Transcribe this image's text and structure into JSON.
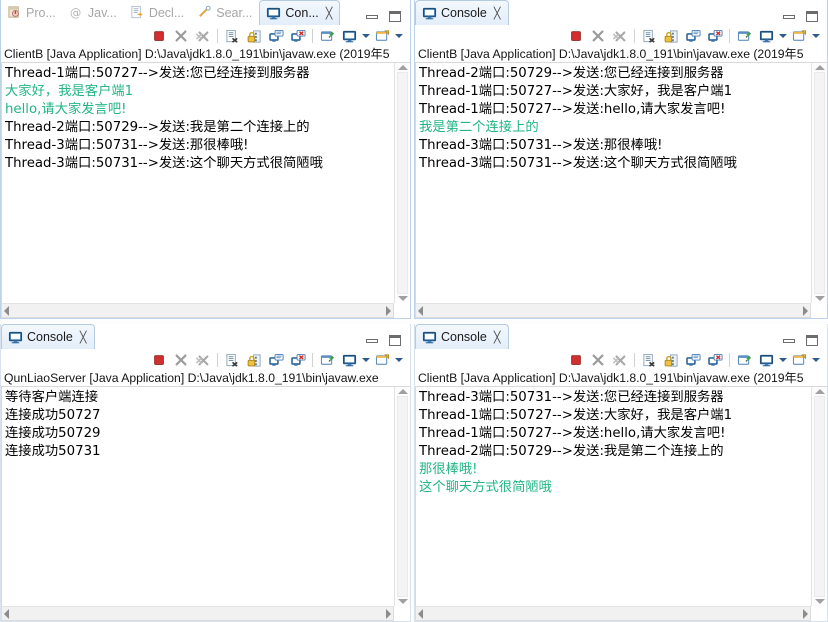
{
  "window": {
    "minimize_label": "Minimize",
    "maximize_label": "Maximize"
  },
  "toolbar": {
    "icons": [
      {
        "name": "terminate-icon",
        "label": "Terminate"
      },
      {
        "name": "remove-launch-icon",
        "label": "Remove Launch"
      },
      {
        "name": "remove-all-terminated-icon",
        "label": "Remove All Terminated Launches"
      },
      {
        "name": "clear-console-icon",
        "label": "Clear Console"
      },
      {
        "name": "scroll-lock-icon",
        "label": "Scroll Lock"
      },
      {
        "name": "show-console-on-output-icon",
        "label": "Show Console When Standard Out Changes"
      },
      {
        "name": "show-console-on-error-icon",
        "label": "Show Console When Standard Error Changes"
      },
      {
        "name": "pin-console-icon",
        "label": "Pin Console"
      },
      {
        "name": "display-selected-console-icon",
        "label": "Display Selected Console"
      },
      {
        "name": "open-console-icon",
        "label": "Open Console"
      }
    ]
  },
  "panels": {
    "top_left": {
      "tabs": [
        {
          "label": "Pro...",
          "icon": "package-explorer-icon",
          "active": false,
          "closable": false
        },
        {
          "label": "Jav...",
          "icon": "javadoc-icon",
          "active": false,
          "closable": false
        },
        {
          "label": "Decl...",
          "icon": "declaration-icon",
          "active": false,
          "closable": false
        },
        {
          "label": "Sear...",
          "icon": "search-icon",
          "active": false,
          "closable": false
        },
        {
          "label": "Con...",
          "icon": "console-icon",
          "active": true,
          "closable": true
        }
      ],
      "launch_line": "ClientB [Java Application] D:\\Java\\jdk1.8.0_191\\bin\\javaw.exe (2019年5",
      "lines": [
        {
          "text": "Thread-1端口:50727-->发送:您已经连接到服务器",
          "color": "black"
        },
        {
          "text": "大家好，我是客户端1",
          "color": "green"
        },
        {
          "text": "hello,请大家发言吧!",
          "color": "green"
        },
        {
          "text": "Thread-2端口:50729-->发送:我是第二个连接上的",
          "color": "black"
        },
        {
          "text": "Thread-3端口:50731-->发送:那很棒哦!",
          "color": "black"
        },
        {
          "text": "Thread-3端口:50731-->发送:这个聊天方式很简陋哦",
          "color": "black"
        }
      ]
    },
    "top_right": {
      "tabs": [
        {
          "label": "Console",
          "icon": "console-icon",
          "active": true,
          "closable": true
        }
      ],
      "launch_line": "ClientB [Java Application] D:\\Java\\jdk1.8.0_191\\bin\\javaw.exe (2019年5",
      "lines": [
        {
          "text": "Thread-2端口:50729-->发送:您已经连接到服务器",
          "color": "black"
        },
        {
          "text": "Thread-1端口:50727-->发送:大家好，我是客户端1",
          "color": "black"
        },
        {
          "text": "Thread-1端口:50727-->发送:hello,请大家发言吧!",
          "color": "black"
        },
        {
          "text": "我是第二个连接上的",
          "color": "green"
        },
        {
          "text": "Thread-3端口:50731-->发送:那很棒哦!",
          "color": "black"
        },
        {
          "text": "Thread-3端口:50731-->发送:这个聊天方式很简陋哦",
          "color": "black"
        }
      ]
    },
    "bottom_left": {
      "tabs": [
        {
          "label": "Console",
          "icon": "console-icon",
          "active": true,
          "closable": true
        }
      ],
      "launch_line": "QunLiaoServer [Java Application] D:\\Java\\jdk1.8.0_191\\bin\\javaw.exe ",
      "lines": [
        {
          "text": "等待客户端连接",
          "color": "black"
        },
        {
          "text": "连接成功50727",
          "color": "black"
        },
        {
          "text": "连接成功50729",
          "color": "black"
        },
        {
          "text": "连接成功50731",
          "color": "black"
        }
      ]
    },
    "bottom_right": {
      "tabs": [
        {
          "label": "Console",
          "icon": "console-icon",
          "active": true,
          "closable": true
        }
      ],
      "launch_line": "ClientB [Java Application] D:\\Java\\jdk1.8.0_191\\bin\\javaw.exe (2019年5",
      "lines": [
        {
          "text": "Thread-3端口:50731-->发送:您已经连接到服务器",
          "color": "black"
        },
        {
          "text": "Thread-1端口:50727-->发送:大家好，我是客户端1",
          "color": "black"
        },
        {
          "text": "Thread-1端口:50727-->发送:hello,请大家发言吧!",
          "color": "black"
        },
        {
          "text": "Thread-2端口:50729-->发送:我是第二个连接上的",
          "color": "black"
        },
        {
          "text": "那很棒哦!",
          "color": "green"
        },
        {
          "text": "这个聊天方式很简陋哦",
          "color": "green"
        }
      ]
    }
  },
  "colors": {
    "console_green": "#23b585",
    "console_black": "#000000",
    "tab_active_bg": "#e9f1fb",
    "terminate_red": "#d42f2f",
    "eclipse_blue": "#2e5a8a"
  },
  "close_glyph": "✄"
}
